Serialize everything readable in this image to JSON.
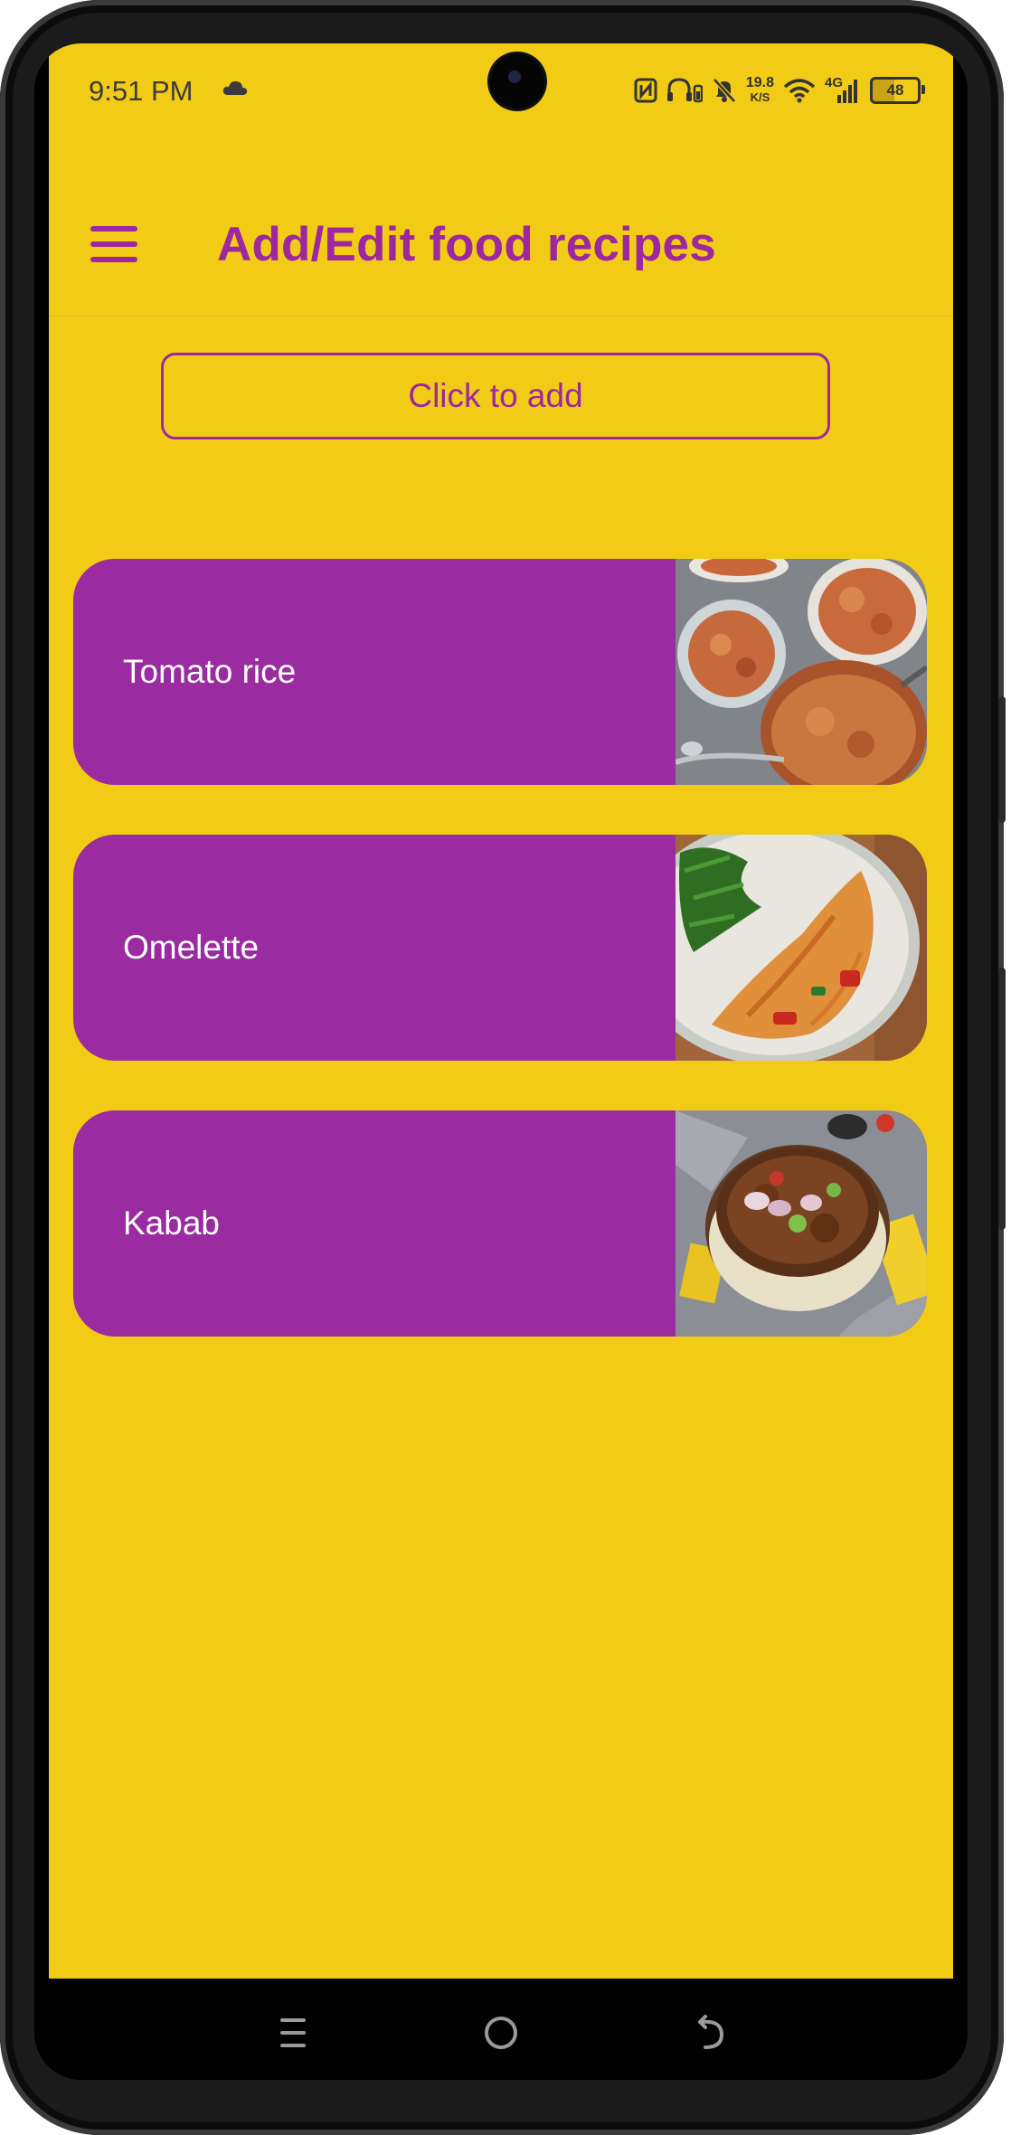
{
  "status_bar": {
    "time": "9:51 PM",
    "net_speed_value": "19.8",
    "net_speed_unit": "K/S",
    "network_type": "4G",
    "battery_level": "48"
  },
  "toolbar": {
    "title": "Add/Edit food recipes"
  },
  "add_button": {
    "label": "Click to add"
  },
  "recipes": [
    {
      "name": "Tomato rice"
    },
    {
      "name": "Omelette"
    },
    {
      "name": "Kabab"
    }
  ],
  "colors": {
    "background": "#F2CB16",
    "accent": "#9C27A0",
    "card": "#9A2BA0",
    "card_text": "#FFFFFF"
  },
  "icons": {
    "menu": "hamburger-menu-icon",
    "nav_recents": "recents-icon",
    "nav_home": "home-circle-icon",
    "nav_back": "back-icon"
  }
}
